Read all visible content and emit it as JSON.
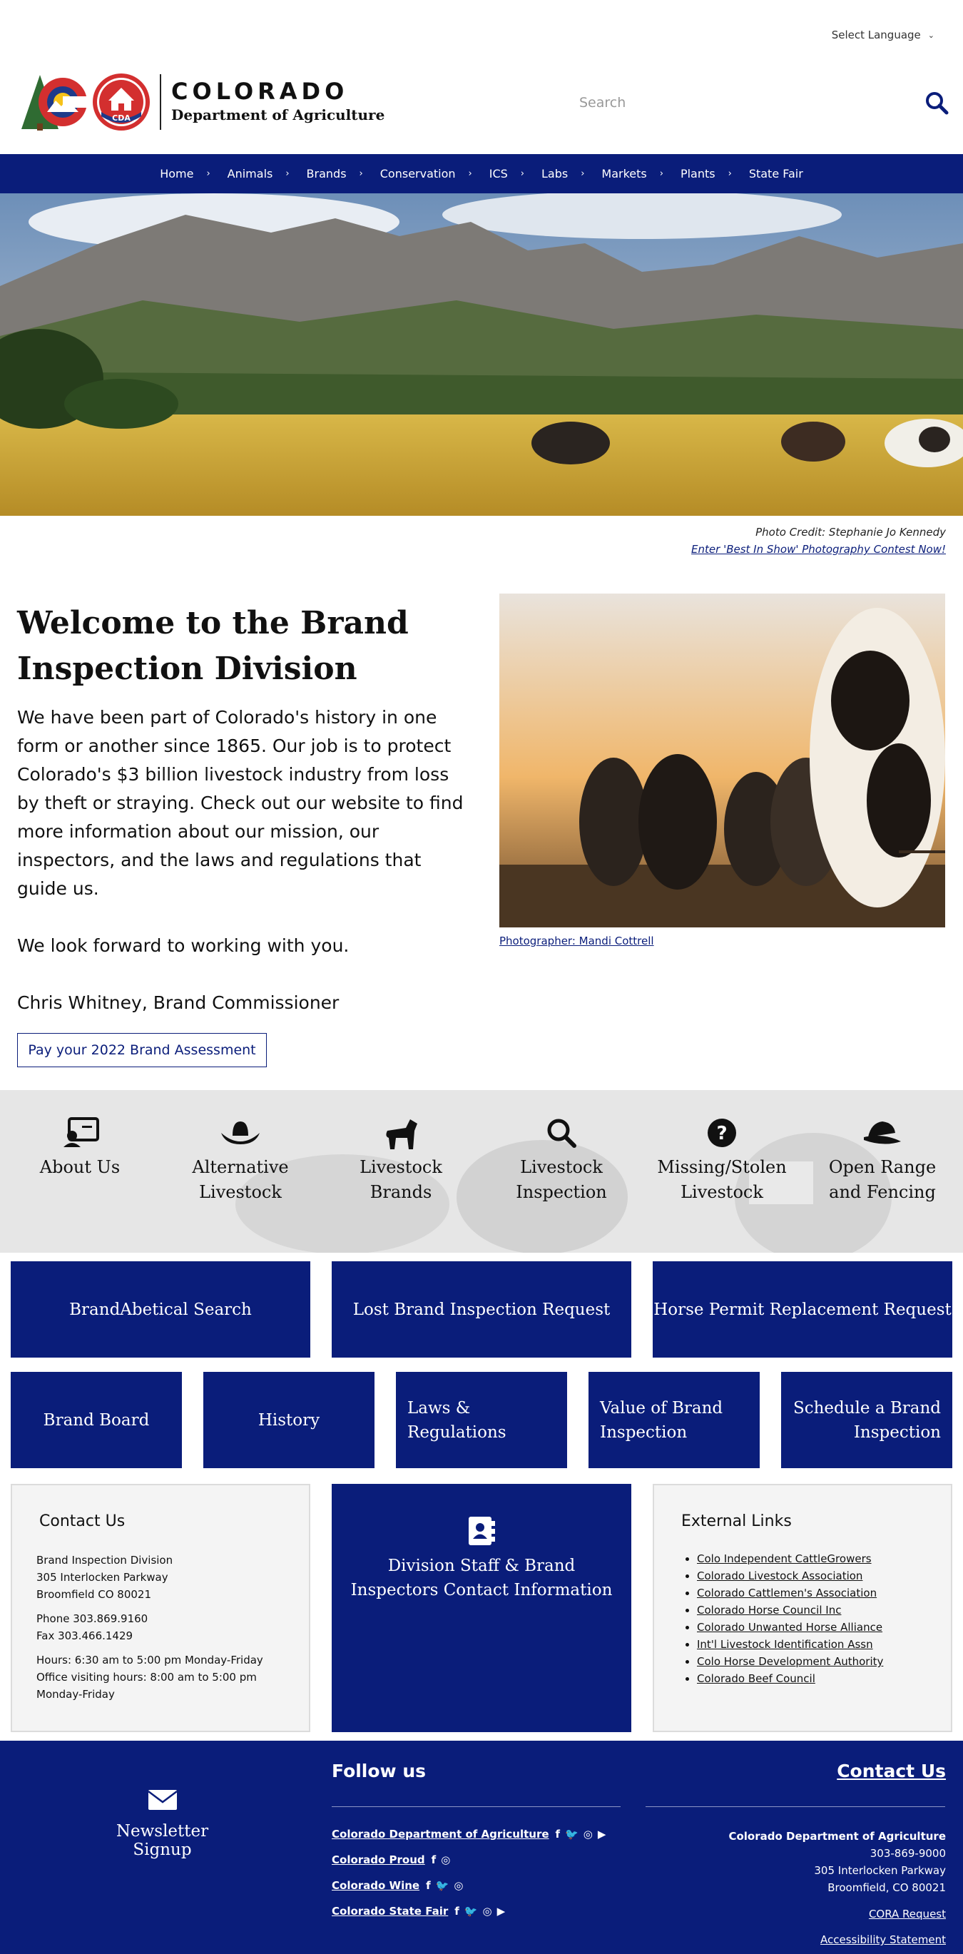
{
  "header": {
    "language_label": "Select Language",
    "logo_title": "COLORADO",
    "logo_subtitle": "Department of Agriculture",
    "logo_badge": "CDA",
    "search_placeholder": "Search"
  },
  "nav": {
    "items": [
      {
        "label": "Home",
        "has_arrow": true
      },
      {
        "label": "Animals",
        "has_arrow": true
      },
      {
        "label": "Brands",
        "has_arrow": true
      },
      {
        "label": "Conservation",
        "has_arrow": true
      },
      {
        "label": "ICS",
        "has_arrow": true
      },
      {
        "label": "Labs",
        "has_arrow": true
      },
      {
        "label": "Markets",
        "has_arrow": true
      },
      {
        "label": "Plants",
        "has_arrow": true
      },
      {
        "label": "State Fair",
        "has_arrow": false
      }
    ]
  },
  "hero": {
    "credit": "Photo Credit: Stephanie Jo Kennedy",
    "contest_link": "Enter 'Best In Show' Photography Contest Now!"
  },
  "welcome": {
    "heading": "Welcome to the Brand Inspection Division",
    "paragraph1": "We have been part of Colorado's history in one form or another since 1865.  Our job is to protect Colorado's $3 billion livestock industry from loss by theft or straying.  Check out our website to find more information about our mission, our inspectors, and the laws and regulations that guide us.",
    "paragraph2": "We look forward to working with you.",
    "signature": "Chris Whitney, Brand Commissioner",
    "assessment_button": "Pay your 2022 Brand Assessment",
    "photo_caption": "Photographer: Mandi Cottrell"
  },
  "icon_band": {
    "items": [
      {
        "label": "About Us",
        "icon": "contact-card-icon"
      },
      {
        "label": "Alternative Livestock",
        "icon": "cowboy-hat-icon"
      },
      {
        "label": "Livestock Brands",
        "icon": "horse-icon"
      },
      {
        "label": "Livestock Inspection",
        "icon": "search-icon"
      },
      {
        "label": "Missing/Stolen Livestock",
        "icon": "question-circle-icon"
      },
      {
        "label": "Open Range and Fencing",
        "icon": "hat-icon"
      }
    ]
  },
  "buttons_row1": [
    "BrandAbetical Search",
    "Lost Brand Inspection Request",
    "Horse Permit Replacement Request"
  ],
  "buttons_row2": [
    "Brand Board",
    "History",
    "Laws & Regulations",
    "Value of Brand Inspection",
    "Schedule a Brand Inspection"
  ],
  "contact_box": {
    "title": "Contact Us",
    "address": [
      "Brand Inspection Division",
      "305 Interlocken Parkway",
      "Broomfield CO 80021"
    ],
    "phone": [
      "Phone 303.869.9160",
      "Fax 303.466.1429"
    ],
    "hours": [
      "Hours: 6:30 am to 5:00 pm Monday-Friday",
      "Office visiting hours: 8:00 am to 5:00 pm Monday-Friday"
    ]
  },
  "staff_box": {
    "label": "Division Staff & Brand Inspectors Contact Information"
  },
  "external_links": {
    "title": "External Links",
    "items": [
      "Colo Independent CattleGrowers",
      "Colorado Livestock Association",
      "Colorado Cattlemen's Association",
      "Colorado Horse Council Inc",
      "Colorado Unwanted Horse Alliance",
      "Int'l Livestock Identification Assn",
      "Colo Horse Development Authority",
      "Colorado Beef Council"
    ]
  },
  "footer": {
    "newsletter": "Newsletter Signup",
    "follow_title": "Follow us",
    "social": [
      {
        "name": "Colorado Department of Agriculture",
        "icons": [
          "f",
          "twitter",
          "instagram",
          "youtube"
        ]
      },
      {
        "name": "Colorado Proud",
        "icons": [
          "f",
          "instagram"
        ]
      },
      {
        "name": "Colorado Wine",
        "icons": [
          "f",
          "twitter",
          "instagram"
        ]
      },
      {
        "name": "Colorado State Fair",
        "icons": [
          "f",
          "twitter",
          "instagram",
          "youtube"
        ]
      }
    ],
    "contact_title": "Contact Us",
    "org": "Colorado Department of Agriculture",
    "phone": "303-869-9000",
    "street": "305 Interlocken Parkway",
    "city": "Broomfield, CO 80021",
    "cora": "CORA Request",
    "accessibility": "Accessibility Statement"
  },
  "colors": {
    "brand_blue": "#0a1d7a",
    "band_gray": "#e6e6e6",
    "box_gray": "#f4f4f4"
  }
}
